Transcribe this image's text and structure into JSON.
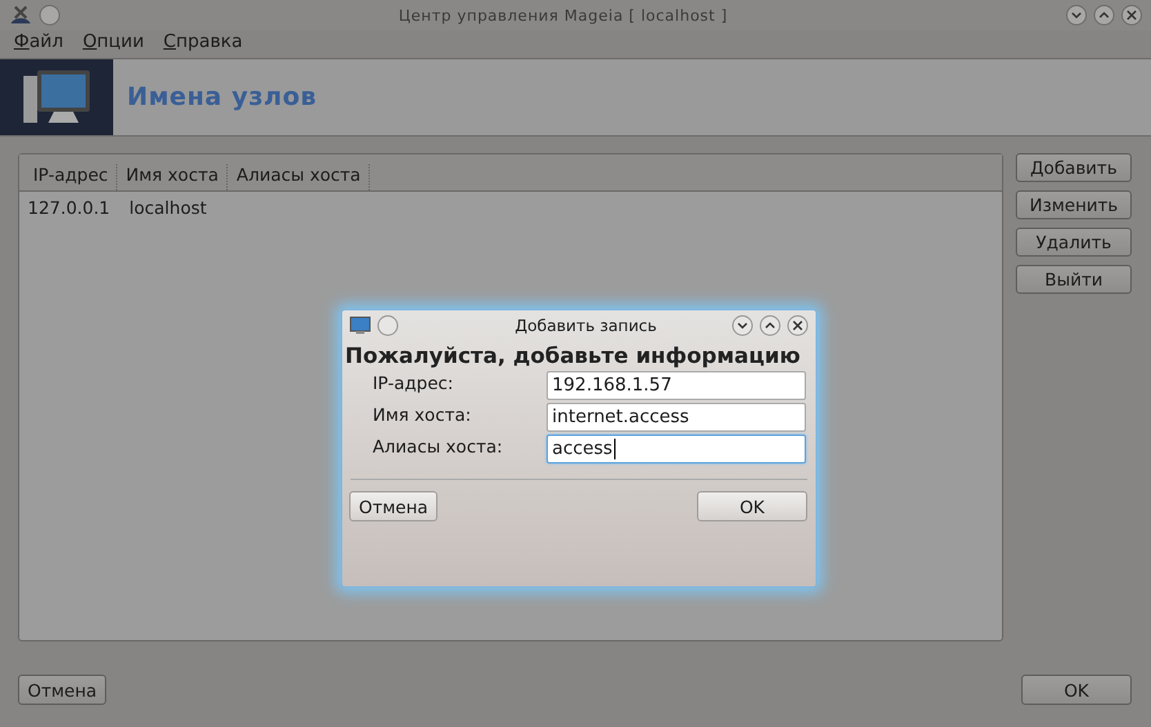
{
  "window": {
    "title": "Центр управления Mageia  [ localhost ]"
  },
  "menu": [
    "Файл",
    "Опции",
    "Справка"
  ],
  "header": {
    "title": "Имена узлов"
  },
  "table": {
    "columns": [
      "IP-адрес",
      "Имя хоста",
      "Алиасы хоста"
    ],
    "rows": [
      [
        "127.0.0.1",
        "localhost",
        ""
      ]
    ]
  },
  "side_buttons": [
    "Добавить",
    "Изменить",
    "Удалить",
    "Выйти"
  ],
  "bottom_buttons": {
    "cancel": "Отмена",
    "ok": "OK"
  },
  "dialog": {
    "title": "Добавить запись",
    "heading": "Пожалуйста, добавьте информацию",
    "fields": [
      {
        "label": "IP-адрес:",
        "value": "192.168.1.57",
        "focused": false
      },
      {
        "label": "Имя хоста:",
        "value": "internet.access",
        "focused": false
      },
      {
        "label": "Алиасы хоста:",
        "value": "access",
        "focused": true
      }
    ],
    "cancel": "Отмена",
    "ok": "OK"
  }
}
